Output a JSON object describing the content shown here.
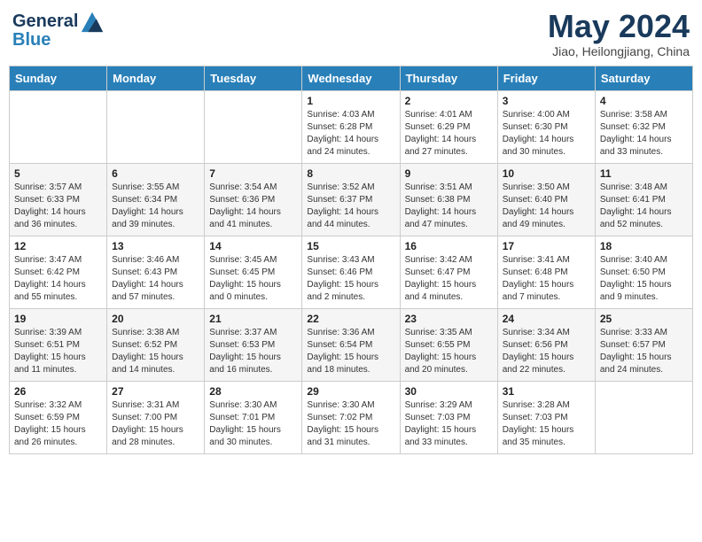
{
  "header": {
    "logo_line1": "General",
    "logo_line2": "Blue",
    "month": "May 2024",
    "location": "Jiao, Heilongjiang, China"
  },
  "weekdays": [
    "Sunday",
    "Monday",
    "Tuesday",
    "Wednesday",
    "Thursday",
    "Friday",
    "Saturday"
  ],
  "weeks": [
    [
      {
        "day": "",
        "info": ""
      },
      {
        "day": "",
        "info": ""
      },
      {
        "day": "",
        "info": ""
      },
      {
        "day": "1",
        "info": "Sunrise: 4:03 AM\nSunset: 6:28 PM\nDaylight: 14 hours\nand 24 minutes."
      },
      {
        "day": "2",
        "info": "Sunrise: 4:01 AM\nSunset: 6:29 PM\nDaylight: 14 hours\nand 27 minutes."
      },
      {
        "day": "3",
        "info": "Sunrise: 4:00 AM\nSunset: 6:30 PM\nDaylight: 14 hours\nand 30 minutes."
      },
      {
        "day": "4",
        "info": "Sunrise: 3:58 AM\nSunset: 6:32 PM\nDaylight: 14 hours\nand 33 minutes."
      }
    ],
    [
      {
        "day": "5",
        "info": "Sunrise: 3:57 AM\nSunset: 6:33 PM\nDaylight: 14 hours\nand 36 minutes."
      },
      {
        "day": "6",
        "info": "Sunrise: 3:55 AM\nSunset: 6:34 PM\nDaylight: 14 hours\nand 39 minutes."
      },
      {
        "day": "7",
        "info": "Sunrise: 3:54 AM\nSunset: 6:36 PM\nDaylight: 14 hours\nand 41 minutes."
      },
      {
        "day": "8",
        "info": "Sunrise: 3:52 AM\nSunset: 6:37 PM\nDaylight: 14 hours\nand 44 minutes."
      },
      {
        "day": "9",
        "info": "Sunrise: 3:51 AM\nSunset: 6:38 PM\nDaylight: 14 hours\nand 47 minutes."
      },
      {
        "day": "10",
        "info": "Sunrise: 3:50 AM\nSunset: 6:40 PM\nDaylight: 14 hours\nand 49 minutes."
      },
      {
        "day": "11",
        "info": "Sunrise: 3:48 AM\nSunset: 6:41 PM\nDaylight: 14 hours\nand 52 minutes."
      }
    ],
    [
      {
        "day": "12",
        "info": "Sunrise: 3:47 AM\nSunset: 6:42 PM\nDaylight: 14 hours\nand 55 minutes."
      },
      {
        "day": "13",
        "info": "Sunrise: 3:46 AM\nSunset: 6:43 PM\nDaylight: 14 hours\nand 57 minutes."
      },
      {
        "day": "14",
        "info": "Sunrise: 3:45 AM\nSunset: 6:45 PM\nDaylight: 15 hours\nand 0 minutes."
      },
      {
        "day": "15",
        "info": "Sunrise: 3:43 AM\nSunset: 6:46 PM\nDaylight: 15 hours\nand 2 minutes."
      },
      {
        "day": "16",
        "info": "Sunrise: 3:42 AM\nSunset: 6:47 PM\nDaylight: 15 hours\nand 4 minutes."
      },
      {
        "day": "17",
        "info": "Sunrise: 3:41 AM\nSunset: 6:48 PM\nDaylight: 15 hours\nand 7 minutes."
      },
      {
        "day": "18",
        "info": "Sunrise: 3:40 AM\nSunset: 6:50 PM\nDaylight: 15 hours\nand 9 minutes."
      }
    ],
    [
      {
        "day": "19",
        "info": "Sunrise: 3:39 AM\nSunset: 6:51 PM\nDaylight: 15 hours\nand 11 minutes."
      },
      {
        "day": "20",
        "info": "Sunrise: 3:38 AM\nSunset: 6:52 PM\nDaylight: 15 hours\nand 14 minutes."
      },
      {
        "day": "21",
        "info": "Sunrise: 3:37 AM\nSunset: 6:53 PM\nDaylight: 15 hours\nand 16 minutes."
      },
      {
        "day": "22",
        "info": "Sunrise: 3:36 AM\nSunset: 6:54 PM\nDaylight: 15 hours\nand 18 minutes."
      },
      {
        "day": "23",
        "info": "Sunrise: 3:35 AM\nSunset: 6:55 PM\nDaylight: 15 hours\nand 20 minutes."
      },
      {
        "day": "24",
        "info": "Sunrise: 3:34 AM\nSunset: 6:56 PM\nDaylight: 15 hours\nand 22 minutes."
      },
      {
        "day": "25",
        "info": "Sunrise: 3:33 AM\nSunset: 6:57 PM\nDaylight: 15 hours\nand 24 minutes."
      }
    ],
    [
      {
        "day": "26",
        "info": "Sunrise: 3:32 AM\nSunset: 6:59 PM\nDaylight: 15 hours\nand 26 minutes."
      },
      {
        "day": "27",
        "info": "Sunrise: 3:31 AM\nSunset: 7:00 PM\nDaylight: 15 hours\nand 28 minutes."
      },
      {
        "day": "28",
        "info": "Sunrise: 3:30 AM\nSunset: 7:01 PM\nDaylight: 15 hours\nand 30 minutes."
      },
      {
        "day": "29",
        "info": "Sunrise: 3:30 AM\nSunset: 7:02 PM\nDaylight: 15 hours\nand 31 minutes."
      },
      {
        "day": "30",
        "info": "Sunrise: 3:29 AM\nSunset: 7:03 PM\nDaylight: 15 hours\nand 33 minutes."
      },
      {
        "day": "31",
        "info": "Sunrise: 3:28 AM\nSunset: 7:03 PM\nDaylight: 15 hours\nand 35 minutes."
      },
      {
        "day": "",
        "info": ""
      }
    ]
  ]
}
